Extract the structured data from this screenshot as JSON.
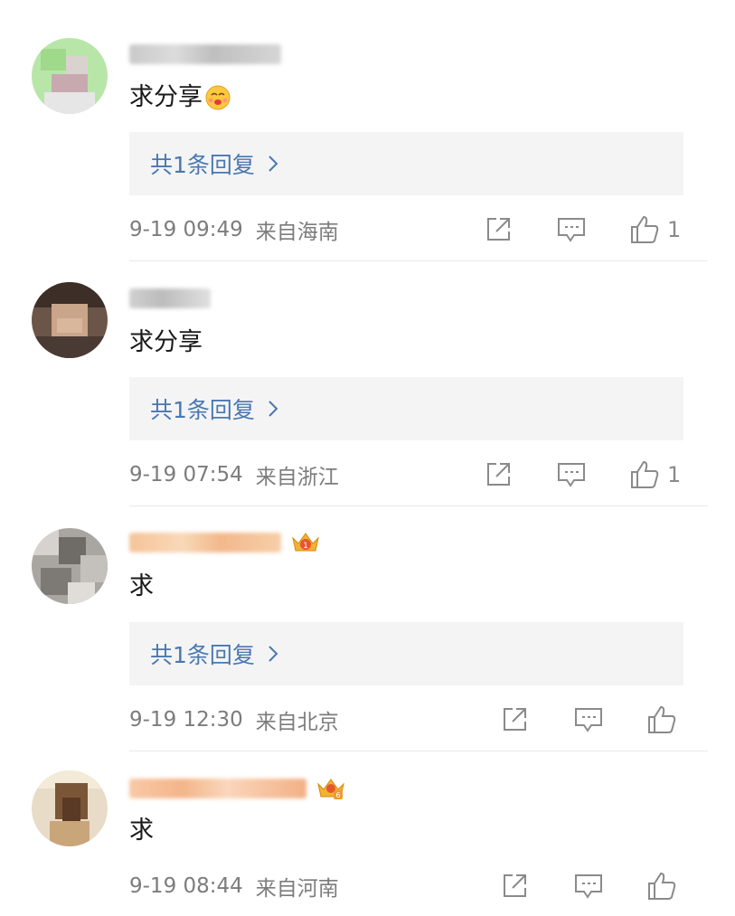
{
  "comments": [
    {
      "text": "求分享",
      "has_emoji": true,
      "reply_label": "共1条回复",
      "date": "9-19 09:49",
      "location": "来自海南",
      "likes": "1"
    },
    {
      "text": "求分享",
      "has_emoji": false,
      "reply_label": "共1条回复",
      "date": "9-19 07:54",
      "location": "来自浙江",
      "likes": "1"
    },
    {
      "text": "求",
      "has_emoji": false,
      "reply_label": "共1条回复",
      "date": "9-19 12:30",
      "location": "来自北京",
      "likes": ""
    },
    {
      "text": "求",
      "has_emoji": false,
      "reply_label": "",
      "date": "9-19 08:44",
      "location": "来自河南",
      "likes": ""
    }
  ],
  "icons": {
    "share": "share-icon",
    "comment": "comment-icon",
    "like": "thumbs-up-icon",
    "reply_chevron": "chevron-right-icon",
    "emoji": "kiss-face-emoji-icon",
    "badge": "crown-badge-icon"
  },
  "colors": {
    "reply_link": "#4a78b0",
    "meta_text": "#7c7c7c",
    "reply_bg": "#f4f4f5",
    "divider": "#e9e9e9"
  }
}
